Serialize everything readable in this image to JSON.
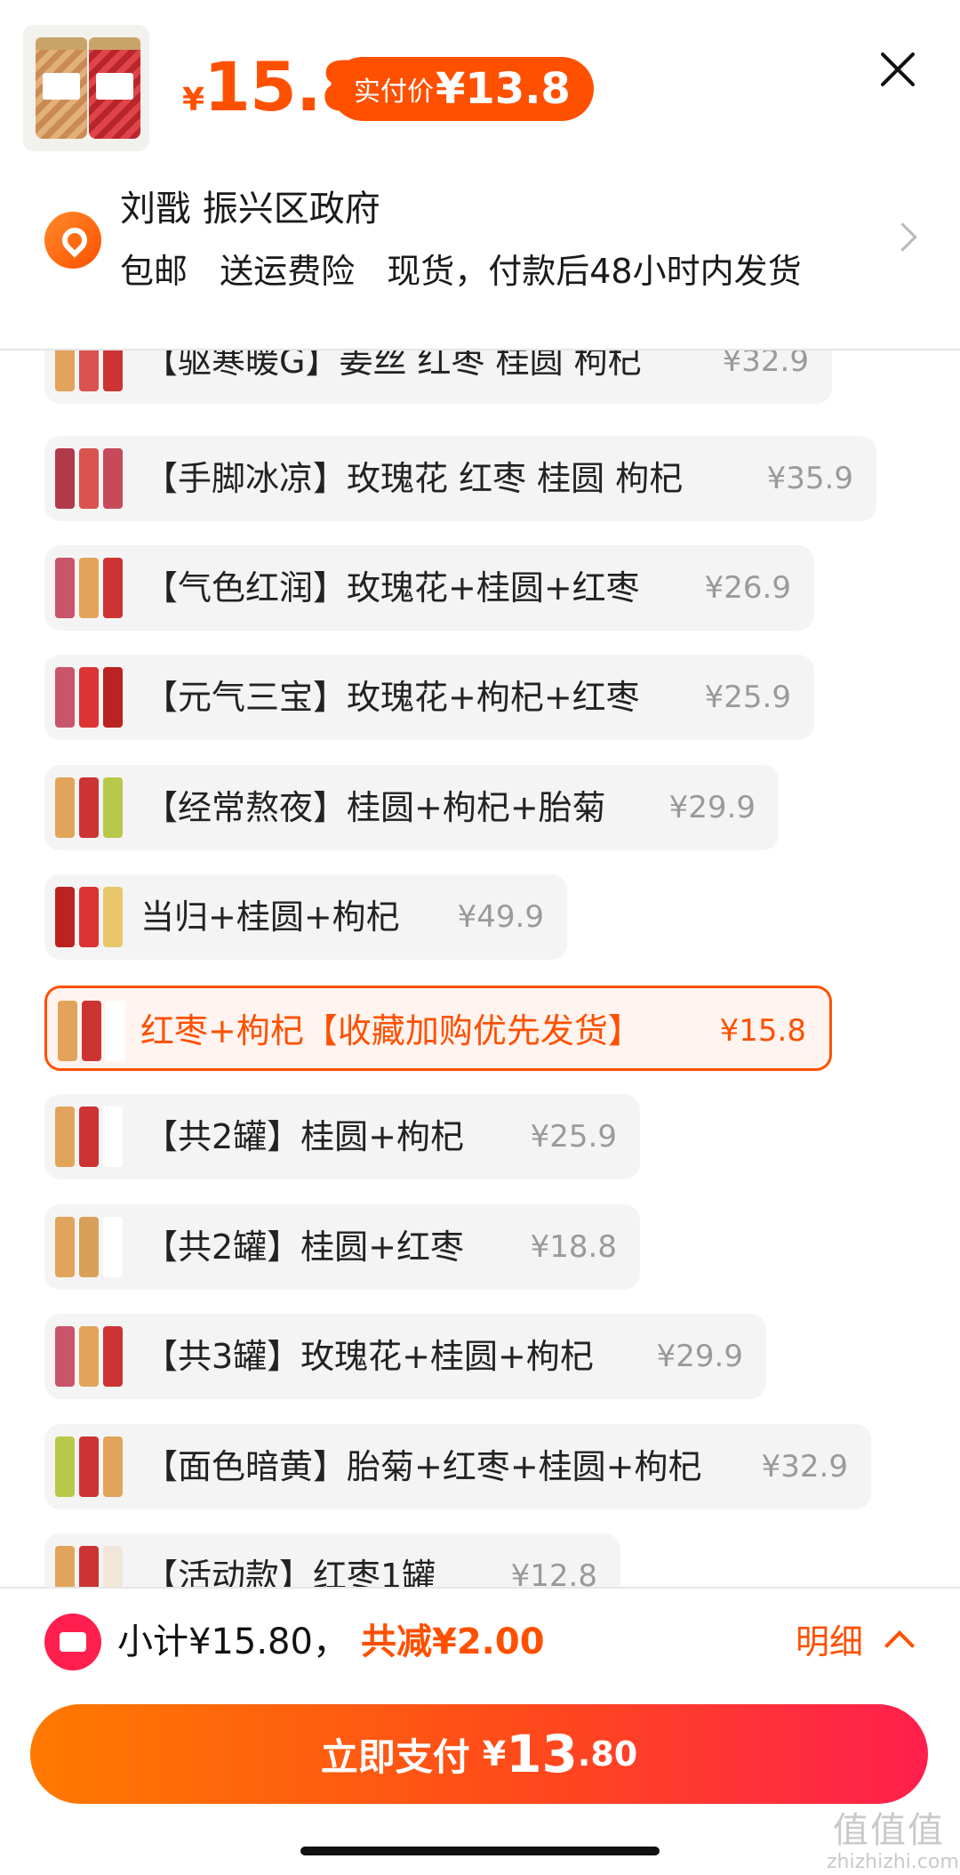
{
  "header": {
    "price_symbol": "¥",
    "price": "15.8",
    "paid_label": "实付价",
    "paid_value": "¥13.8"
  },
  "address": {
    "name": "刘戬 振兴区政府",
    "tags": [
      "包邮",
      "送运费险",
      "现货，付款后48小时内发货"
    ]
  },
  "skus": [
    {
      "name": "【驱寒暖G】姜丝 红枣 桂圆 枸杞",
      "price": "¥32.9"
    },
    {
      "name": "【手脚冰凉】玫瑰花 红枣 桂圆 枸杞",
      "price": "¥35.9"
    },
    {
      "name": "【气色红润】玫瑰花+桂圆+红枣",
      "price": "¥26.9"
    },
    {
      "name": "【元气三宝】玫瑰花+枸杞+红枣",
      "price": "¥25.9"
    },
    {
      "name": "【经常熬夜】桂圆+枸杞+胎菊",
      "price": "¥29.9"
    },
    {
      "name": "当归+桂圆+枸杞",
      "price": "¥49.9"
    },
    {
      "name": "红枣+枸杞【收藏加购优先发货】",
      "price": "¥15.8"
    },
    {
      "name": "【共2罐】桂圆+枸杞",
      "price": "¥25.9"
    },
    {
      "name": "【共2罐】桂圆+红枣",
      "price": "¥18.8"
    },
    {
      "name": "【共3罐】玫瑰花+桂圆+枸杞",
      "price": "¥29.9"
    },
    {
      "name": "【面色暗黄】胎菊+红枣+桂圆+枸杞",
      "price": "¥32.9"
    },
    {
      "name": "【活动款】红枣1罐",
      "price": "¥12.8"
    }
  ],
  "footer": {
    "subtotal": "小计¥15.80，",
    "discount": "共减¥2.00",
    "detail": "明细",
    "pay_label": "立即支付",
    "pay_currency": "¥",
    "pay_int": "13",
    "pay_dec": ".80",
    "watermark_big": "值值值",
    "watermark_small": "zhizhizhi.com"
  },
  "colors": {
    "accent": "#ff5000",
    "pay_gradient_start": "#ff7a00",
    "pay_gradient_end": "#ff1f4e",
    "chip_bg": "#f4f4f4"
  }
}
